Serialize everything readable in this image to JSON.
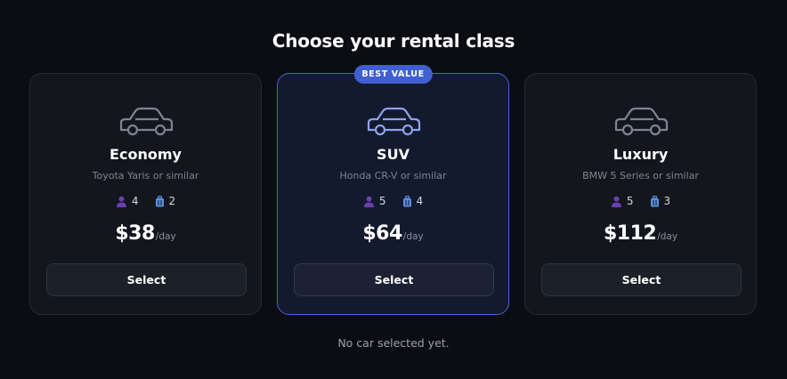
{
  "heading": "Choose your rental class",
  "badge_label": "BEST VALUE",
  "cards": [
    {
      "name": "Economy",
      "model": "Toyota Yaris or similar",
      "seats": "4",
      "bags": "2",
      "price": "$38",
      "per": "/day",
      "button": "Select",
      "featured": false,
      "icon": "car-outline-icon",
      "icon_color": "#7e8494"
    },
    {
      "name": "SUV",
      "model": "Honda CR-V or similar",
      "seats": "5",
      "bags": "4",
      "price": "$64",
      "per": "/day",
      "button": "Select",
      "featured": true,
      "icon": "car-outline-icon",
      "icon_color": "#8fa2ea"
    },
    {
      "name": "Luxury",
      "model": "BMW 5 Series or similar",
      "seats": "5",
      "bags": "3",
      "price": "$112",
      "per": "/day",
      "button": "Select",
      "featured": false,
      "icon": "car-outline-icon",
      "icon_color": "#7e8494"
    }
  ],
  "status_text": "No car selected yet.",
  "colors": {
    "background": "#0b0d12",
    "card": "#13161d",
    "featured_card": "#131a2e",
    "accent": "#3f5fd3",
    "seat_icon": "#6a3fb0",
    "bag_icon": "#5a8ee0"
  }
}
